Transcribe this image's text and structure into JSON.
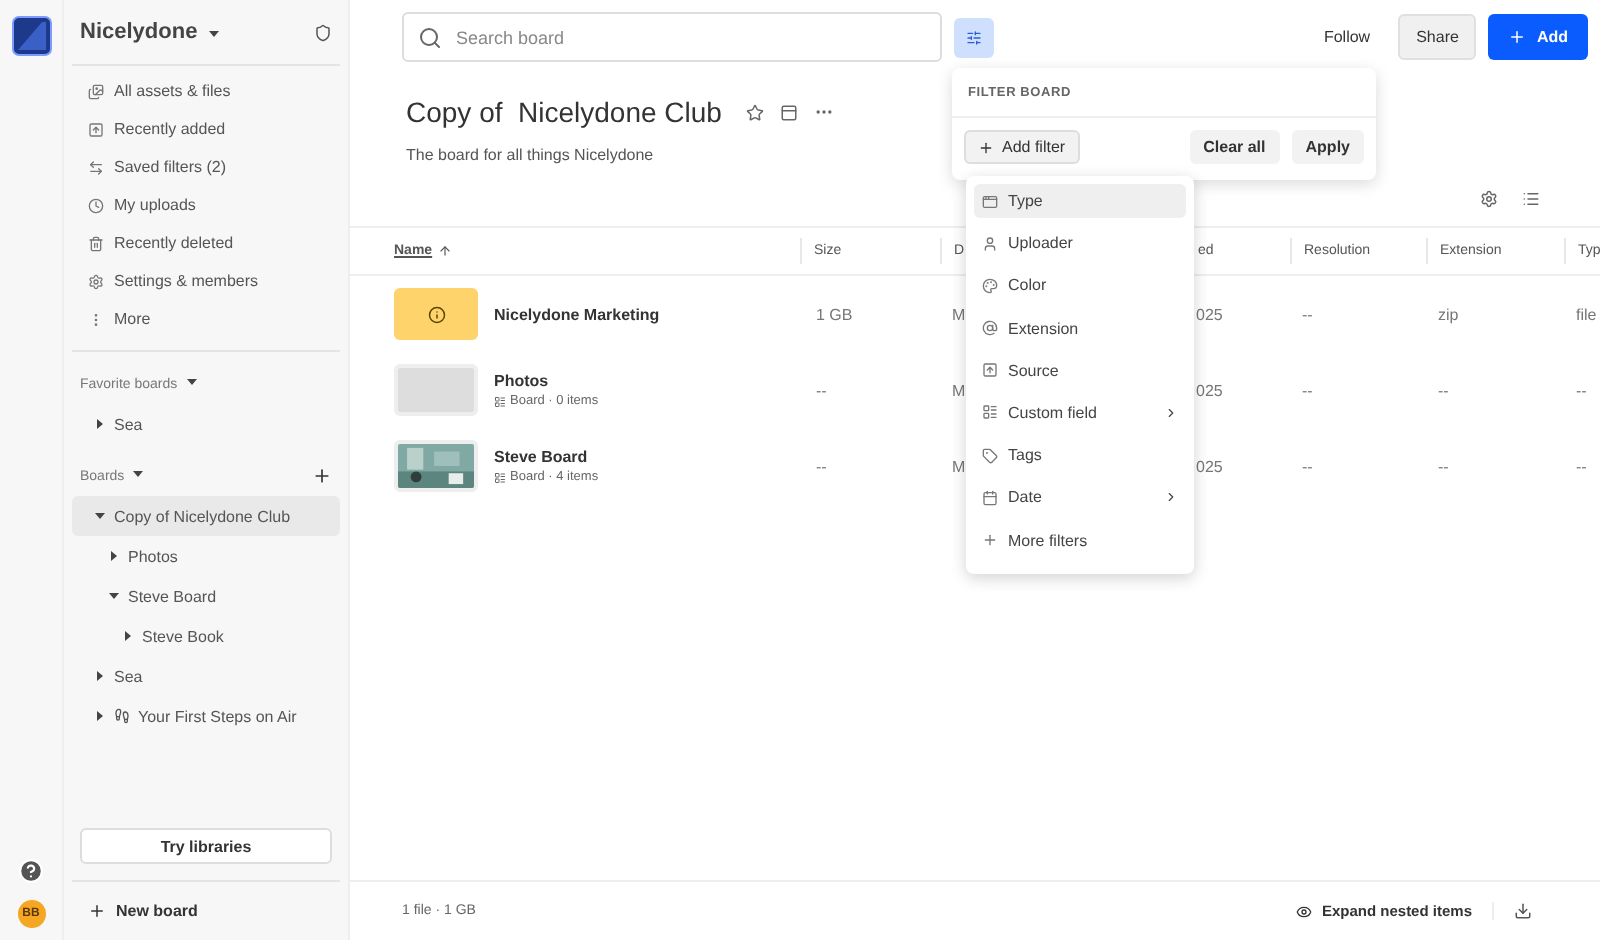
{
  "workspace": {
    "name": "Nicelydone",
    "avatar": "BB"
  },
  "nav": [
    {
      "label": "All assets & files"
    },
    {
      "label": "Recently added"
    },
    {
      "label": "Saved filters (2)"
    },
    {
      "label": "My uploads"
    },
    {
      "label": "Recently deleted"
    },
    {
      "label": "Settings & members"
    },
    {
      "label": "More"
    }
  ],
  "favorites": {
    "title": "Favorite boards",
    "items": [
      {
        "label": "Sea",
        "expanded": false,
        "selected": false
      }
    ]
  },
  "boards": {
    "title": "Boards",
    "items": [
      {
        "label": "Copy of Nicelydone Club",
        "expanded": true,
        "selected": true,
        "children": [
          {
            "label": "Photos",
            "expanded": false,
            "selected": false
          },
          {
            "label": "Steve Board",
            "expanded": true,
            "selected": false,
            "children": [
              {
                "label": "Steve Book",
                "expanded": false,
                "selected": false
              }
            ]
          }
        ]
      },
      {
        "label": "Sea",
        "expanded": false,
        "selected": false
      },
      {
        "label": "Your First Steps on Air",
        "expanded": false,
        "selected": false,
        "has_icon": true
      }
    ]
  },
  "try_libraries": "Try libraries",
  "new_board": "New board",
  "search": {
    "placeholder": "Search board"
  },
  "filter_button": {
    "selected": true
  },
  "actions": {
    "follow": "Follow",
    "share": "Share",
    "add": "Add"
  },
  "board": {
    "title": "Copy of  Nicelydone Club",
    "description": "The board for all things Nicelydone"
  },
  "table": {
    "columns": [
      {
        "label": "Name",
        "sorted": true
      },
      {
        "label": "Size",
        "sorted": false
      },
      {
        "label": "D",
        "sorted": false
      },
      {
        "label": "ed",
        "sorted": false
      },
      {
        "label": "Resolution",
        "sorted": false
      },
      {
        "label": "Extension",
        "sorted": false
      },
      {
        "label": "Typ",
        "sorted": false
      }
    ],
    "rows": [
      {
        "kind": "file",
        "cells": [
          "Nicelydone Marketing",
          "1 GB",
          "M",
          "025",
          "--",
          "zip",
          "file"
        ]
      },
      {
        "kind": "empty",
        "subtitle": "Board · 0 items",
        "cells": [
          "Photos",
          "--",
          "M",
          "025",
          "--",
          "--",
          "--"
        ]
      },
      {
        "kind": "picture",
        "subtitle": "Board · 4 items",
        "cells": [
          "Steve Board",
          "--",
          "M",
          "025",
          "--",
          "--",
          "--"
        ]
      }
    ]
  },
  "filter_popup": {
    "title": "FILTER BOARD",
    "add_filter": "Add filter",
    "clear": "Clear all",
    "apply": "Apply",
    "options": [
      {
        "label": "Type",
        "selected": true,
        "submenu": false
      },
      {
        "label": "Uploader",
        "selected": false,
        "submenu": false
      },
      {
        "label": "Color",
        "selected": false,
        "submenu": false
      },
      {
        "label": "Extension",
        "selected": false,
        "submenu": false
      },
      {
        "label": "Source",
        "selected": false,
        "submenu": false
      },
      {
        "label": "Custom field",
        "selected": false,
        "submenu": true
      },
      {
        "label": "Tags",
        "selected": false,
        "submenu": false
      },
      {
        "label": "Date",
        "selected": false,
        "submenu": true
      },
      {
        "label": "More filters",
        "selected": false,
        "submenu": false
      }
    ]
  },
  "status": {
    "summary": "1 file · 1 GB",
    "expand": "Expand nested items"
  }
}
